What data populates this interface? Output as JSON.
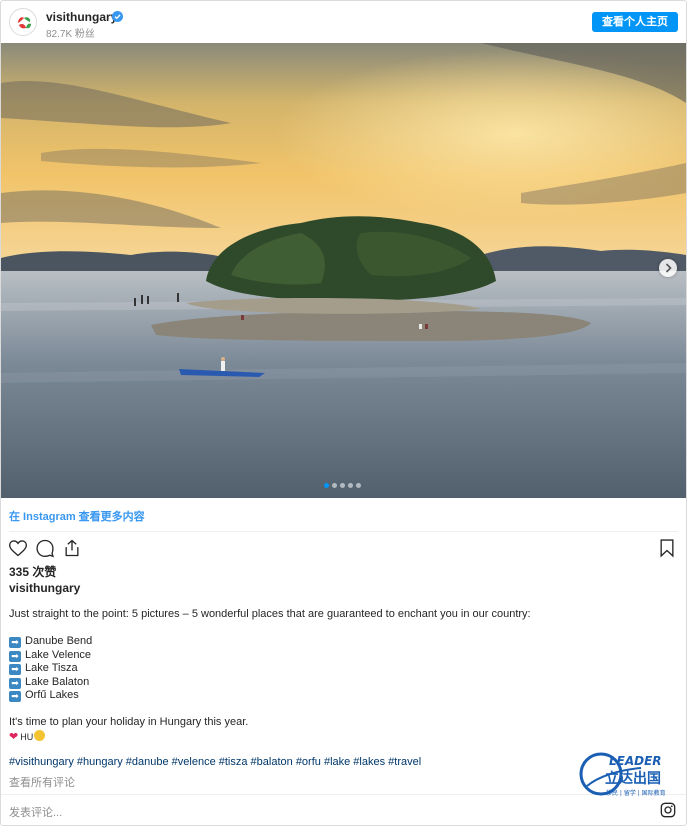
{
  "header": {
    "username": "visithungary",
    "followers": "82.7K 粉丝",
    "view_profile_label": "查看个人主页"
  },
  "photo": {
    "alt_icons": [
      "next-arrow-icon"
    ],
    "carousel_count": 5,
    "carousel_active": 1
  },
  "more_link": "在 Instagram 查看更多内容",
  "likes": "335 次赞",
  "caption": {
    "username": "visithungary",
    "intro": "Just straight to the point: 5 pictures – 5 wonderful places that are guaranteed to enchant you in our country:",
    "places": [
      "Danube Bend",
      "Lake Velence",
      "Lake Tisza",
      "Lake Balaton",
      "Orfű Lakes"
    ],
    "closing": "It's time to plan your holiday in Hungary this year.",
    "flag_text": "HU",
    "hashtags": "#visithungary #hungary #danube #velence #tisza #balaton #orfu #lake #lakes #travel"
  },
  "view_comments": "查看所有评论",
  "add_comment_placeholder": "发表评论...",
  "watermark": {
    "brand": "LEADER",
    "chinese": "立达出国",
    "tagline": "移民 | 留学 | 国际教育"
  },
  "colors": {
    "accent": "#0095f6",
    "link": "#3897f0",
    "hashtag": "#00376b",
    "muted": "#8e8e8e"
  }
}
